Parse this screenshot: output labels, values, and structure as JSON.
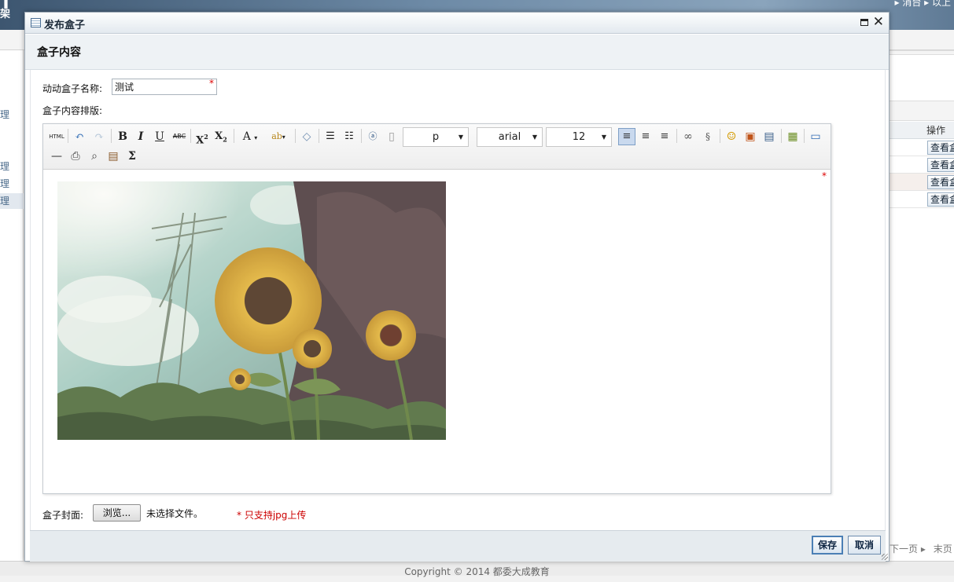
{
  "background": {
    "logo_fragment_top": "T",
    "logo_fragment_bottom": "架",
    "top_links": "▸ 消台 ▸ 以上",
    "sidebar_items": [
      "理",
      "理",
      "理",
      "理"
    ],
    "table_header": "操作",
    "view_button_label": "查看盒",
    "pager_next": "下一页",
    "pager_last": "末页",
    "footer": "Copyright © 2014 都委大成教育"
  },
  "dialog": {
    "title": "发布盒子",
    "header": "盒子内容",
    "name_label": "动动盒子名称:",
    "name_value": "测试",
    "required_mark": "*",
    "layout_label": "盒子内容排版:",
    "cover_label": "盒子封面:",
    "browse_label": "浏览...",
    "file_status": "未选择文件。",
    "cover_hint": "* 只支持jpg上传",
    "save_label": "保存",
    "cancel_label": "取消"
  },
  "editor": {
    "html_label": "HTML",
    "paragraph_value": "p",
    "font_value": "arial",
    "size_value": "12",
    "active_button": "align-left",
    "toolbar_row1_icons": [
      "html-icon",
      "undo-icon",
      "redo-icon",
      "bold-icon",
      "italic-icon",
      "underline-icon",
      "strikethrough-icon",
      "superscript-icon",
      "subscript-icon",
      "font-color-icon",
      "highlight-icon",
      "eraser-icon",
      "ordered-list-icon",
      "unordered-list-icon",
      "paste-text-icon",
      "blank-page-icon",
      "align-left-icon",
      "align-center-icon",
      "align-right-icon",
      "link-icon",
      "unlink-icon",
      "emoticon-icon",
      "image-icon",
      "video-icon",
      "insert-image-icon",
      "preview-icon"
    ],
    "toolbar_row2_icons": [
      "horizontal-rule-icon",
      "print-icon",
      "search-icon",
      "paste-icon",
      "formula-icon"
    ]
  },
  "colors": {
    "accent": "#4b7fb5",
    "required": "#dd0000"
  }
}
